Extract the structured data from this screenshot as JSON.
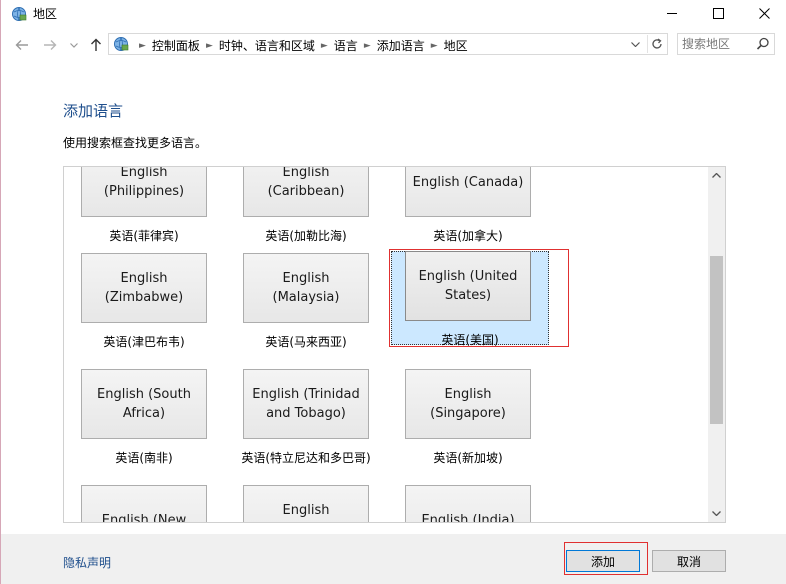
{
  "window": {
    "title": "地区"
  },
  "navbar": {
    "breadcrumbs": [
      "控制面板",
      "时钟、语言和区域",
      "语言",
      "添加语言",
      "地区"
    ],
    "search_placeholder": "搜索地区"
  },
  "main": {
    "title": "添加语言",
    "subtitle": "使用搜索框查找更多语言。"
  },
  "languages": [
    {
      "name": "English (Philippines)",
      "display": "English\n(Philippines)",
      "caption": "英语(菲律宾)"
    },
    {
      "name": "English (Caribbean)",
      "display": "English\n(Caribbean)",
      "caption": "英语(加勒比海)"
    },
    {
      "name": "English (Canada)",
      "display": "English (Canada)",
      "caption": "英语(加拿大)"
    },
    {
      "name": "English (Zimbabwe)",
      "display": "English\n(Zimbabwe)",
      "caption": "英语(津巴布韦)"
    },
    {
      "name": "English (Malaysia)",
      "display": "English (Malaysia)",
      "caption": "英语(马来西亚)"
    },
    {
      "name": "English (United States)",
      "display": "English (United\nStates)",
      "caption": "英语(美国)",
      "selected": true
    },
    {
      "name": "English (South Africa)",
      "display": "English (South\nAfrica)",
      "caption": "英语(南非)"
    },
    {
      "name": "English (Trinidad and Tobago)",
      "display": "English (Trinidad\nand Tobago)",
      "caption": "英语(特立尼达和多巴哥)"
    },
    {
      "name": "English (Singapore)",
      "display": "English\n(Singapore)",
      "caption": "英语(新加坡)"
    },
    {
      "name": "English (New Zealand)",
      "display": "English (New",
      "caption": ""
    },
    {
      "name": "English (Jamaica)",
      "display": "English (Jamaica)",
      "caption": ""
    },
    {
      "name": "English (India)",
      "display": "English (India)",
      "caption": ""
    }
  ],
  "footer": {
    "privacy_label": "隐私声明",
    "add_label": "添加",
    "cancel_label": "取消"
  },
  "colors": {
    "accent": "#1e4e8c",
    "selection": "#cce8ff",
    "highlight": "#e03030"
  }
}
